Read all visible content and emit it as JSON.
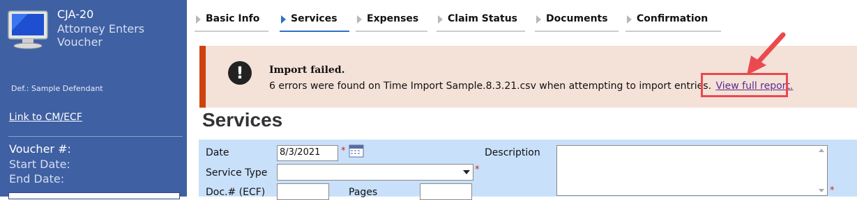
{
  "sidebar": {
    "form_code": "CJA-20",
    "form_title": "Attorney Enters Voucher",
    "defendant": "Def.: Sample Defendant",
    "cmecf_link": "Link to CM/ECF",
    "voucher_label": "Voucher #:",
    "start_date_label": "Start Date:",
    "end_date_label": "End Date:",
    "monitor_icon": "monitor-icon"
  },
  "tabs": [
    {
      "label": "Basic Info",
      "active": false
    },
    {
      "label": "Services",
      "active": true
    },
    {
      "label": "Expenses",
      "active": false
    },
    {
      "label": "Claim Status",
      "active": false
    },
    {
      "label": "Documents",
      "active": false
    },
    {
      "label": "Confirmation",
      "active": false
    }
  ],
  "alert": {
    "title": "Import failed.",
    "message": "6 errors were found on Time Import Sample.8.3.21.csv when attempting to import entries.",
    "link": "View full report.",
    "icon": "exclamation-icon",
    "border_color": "#cc4311",
    "background": "#f4e1d8",
    "highlight_color": "#e8494f"
  },
  "page": {
    "heading": "Services"
  },
  "form": {
    "date_label": "Date",
    "date_value": "8/3/2021",
    "service_type_label": "Service Type",
    "service_type_value": "",
    "doc_label": "Doc.# (ECF)",
    "doc_value": "",
    "pages_label": "Pages",
    "pages_value": "",
    "description_label": "Description",
    "description_value": "",
    "required_mark": "*",
    "calendar_icon": "calendar-icon"
  },
  "colors": {
    "sidebar_bg": "#3f60a3",
    "form_bg": "#c9e0fa",
    "active_tab": "#2f70c4"
  }
}
